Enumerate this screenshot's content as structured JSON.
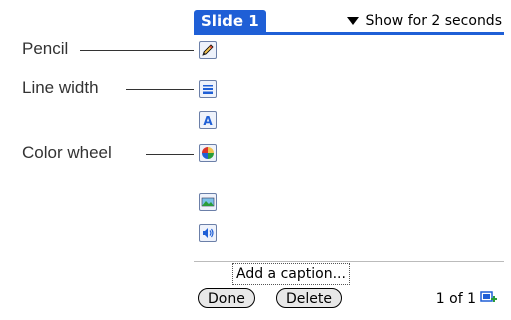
{
  "callouts": {
    "pencil": "Pencil",
    "line_width": "Line width",
    "color_wheel": "Color wheel"
  },
  "header": {
    "title": "Slide 1",
    "show_for": "Show for 2 seconds"
  },
  "toolbar": {
    "icons": [
      "pencil-icon",
      "line-width-icon",
      "text-icon",
      "color-wheel-icon",
      "image-icon",
      "sound-icon"
    ]
  },
  "caption": {
    "placeholder": "Add a caption..."
  },
  "footer": {
    "done_label": "Done",
    "delete_label": "Delete",
    "page_indicator": "1 of 1"
  },
  "colors": {
    "accent": "#1f5fd6"
  }
}
